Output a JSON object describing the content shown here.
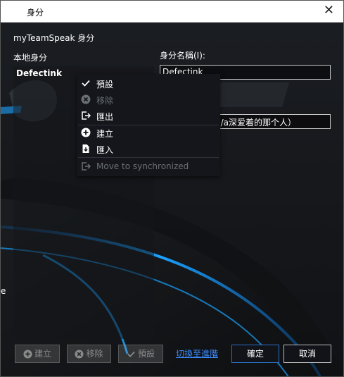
{
  "window": {
    "title": "身分",
    "close_glyph": "✕"
  },
  "header": {
    "section_title": "myTeamSpeak 身分"
  },
  "left": {
    "label": "本地身分",
    "items": [
      {
        "label": "Defectink"
      }
    ]
  },
  "right": {
    "name_label": "身分名稱(I):",
    "name_value": "Defectink",
    "nick_value": "/a深爱着的那个人）"
  },
  "context_menu": {
    "items": [
      {
        "label": "預設",
        "icon": "check-icon",
        "enabled": true
      },
      {
        "label": "移除",
        "icon": "remove-circle-icon",
        "enabled": false
      },
      {
        "label": "匯出",
        "icon": "export-icon",
        "enabled": true
      },
      {
        "label": "建立",
        "icon": "add-circle-icon",
        "enabled": true
      },
      {
        "label": "匯入",
        "icon": "import-file-icon",
        "enabled": true
      },
      {
        "label": "Move to synchronized",
        "icon": "move-icon",
        "enabled": false
      }
    ]
  },
  "footer": {
    "add_label": "建立",
    "remove_label": "移除",
    "default_label": "預設",
    "switch_link": "切換至進階",
    "ok_label": "確定",
    "cancel_label": "取消"
  },
  "misc": {
    "edge_letter": "e"
  },
  "colors": {
    "accent": "#2a6fc2",
    "link": "#3a8cff",
    "glow": "#1aa3ff"
  }
}
